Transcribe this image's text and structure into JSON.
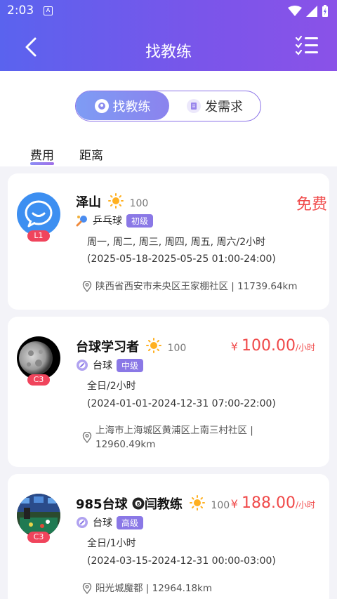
{
  "status_bar": {
    "time": "2:03",
    "app_icon": "A"
  },
  "header": {
    "title": "找教练"
  },
  "segments": {
    "left_label": "找教练",
    "right_label": "发需求"
  },
  "sort_tabs": [
    {
      "label": "费用",
      "active": true
    },
    {
      "label": "距离",
      "active": false
    }
  ],
  "coaches": [
    {
      "name": "泽山",
      "score": "100",
      "level": "L1",
      "price_free": "免费",
      "sport": "乒乓球",
      "grade": "初级",
      "schedule": "周一, 周二, 周三, 周四, 周五, 周六/2小时",
      "period": "(2025-05-18-2025-05-25 01:00-24:00)",
      "address": "陕西省西安市未央区王家棚社区 | 11739.64km"
    },
    {
      "name": "台球学习者",
      "score": "100",
      "level": "C3",
      "price_currency": "¥",
      "price_value": "100.00",
      "price_unit": "/小时",
      "sport": "台球",
      "grade": "中级",
      "schedule": "全日/2小时",
      "period": "(2024-01-01-2024-12-31 07:00-22:00)",
      "address_line1": "上海市上海城区黄浦区上南三村社区 |",
      "address_line2": "12960.49km"
    },
    {
      "name_part1": "985台球",
      "name_part2": "闫教练",
      "score": "100",
      "level": "C3",
      "price_currency": "¥",
      "price_value": "188.00",
      "price_unit": "/小时",
      "sport": "台球",
      "grade": "高级",
      "schedule": "全日/1小时",
      "period": "(2024-03-15-2024-12-31 00:00-03:00)",
      "address": "阳光城魔都 | 12964.18km"
    }
  ],
  "colors": {
    "header_start": "#5a63ee",
    "header_end": "#8a52e8",
    "price": "#f04a4a",
    "badge": "#8a78e6",
    "level": "#f0445c"
  }
}
